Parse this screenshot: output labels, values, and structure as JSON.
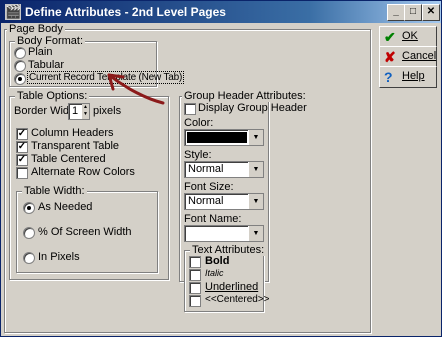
{
  "window": {
    "title": "Define Attributes - 2nd Level Pages",
    "min_label": "_",
    "max_label": "□",
    "close_label": "✕"
  },
  "page_body": {
    "label": "Page Body",
    "body_format": {
      "label": "Body Format:",
      "options": [
        "Plain",
        "Tabular",
        "Current Record Template (New Tab)"
      ],
      "selected": 2
    },
    "table_options": {
      "label": "Table Options:",
      "border_width_label": "Border Width:",
      "border_width_value": "1",
      "border_width_unit": "pixels",
      "checkboxes": [
        {
          "label": "Column Headers",
          "checked": true
        },
        {
          "label": "Transparent Table",
          "checked": true
        },
        {
          "label": "Table Centered",
          "checked": true
        },
        {
          "label": "Alternate Row Colors",
          "checked": false
        }
      ],
      "table_width": {
        "label": "Table Width:",
        "options": [
          "As Needed",
          "% Of Screen Width",
          "In Pixels"
        ],
        "selected": 0
      }
    },
    "group_header": {
      "label": "Group Header Attributes:",
      "display_label": "Display Group Header",
      "display_checked": false,
      "color_label": "Color:",
      "color_value": "#000000",
      "style_label": "Style:",
      "style_value": "Normal",
      "font_size_label": "Font Size:",
      "font_size_value": "Normal",
      "font_name_label": "Font Name:",
      "font_name_value": "",
      "text_attributes": {
        "label": "Text Attributes:",
        "items": [
          "Bold",
          "Italic",
          "Underlined",
          "<<Centered>>"
        ]
      }
    }
  },
  "buttons": {
    "ok": "OK",
    "cancel": "Cancel",
    "help": "Help"
  },
  "colors": {
    "accent_arrow": "#8b1a1a",
    "ok_icon": "#008000",
    "cancel_icon": "#c00000",
    "help_icon": "#1060c0"
  }
}
